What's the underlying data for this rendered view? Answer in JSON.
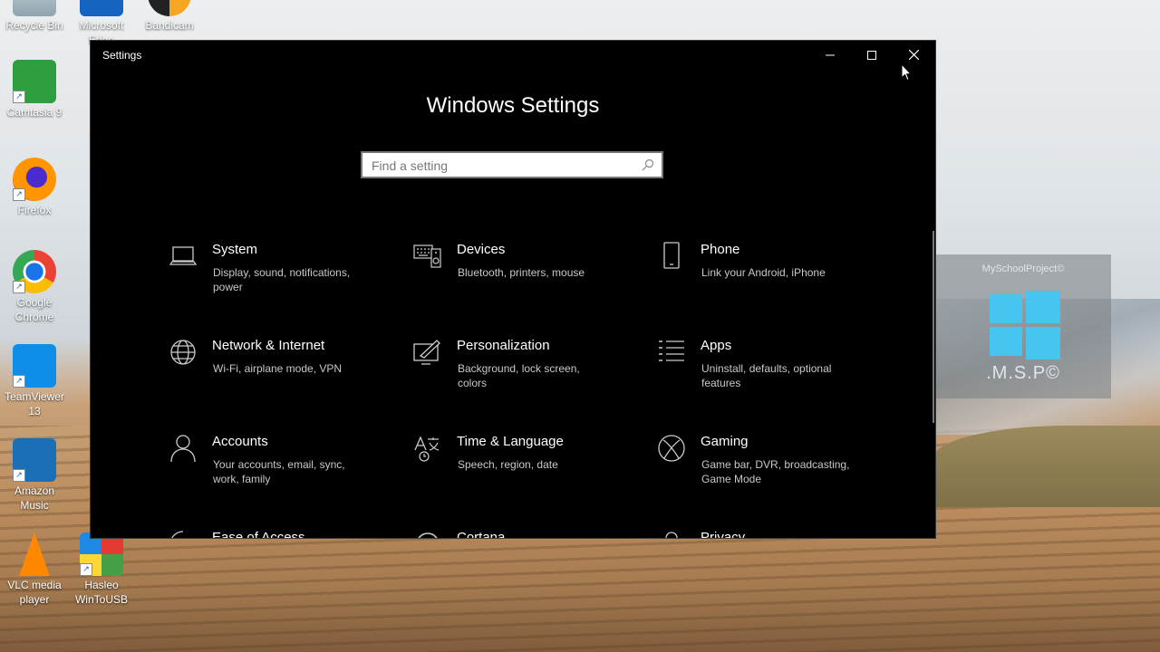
{
  "desktop": {
    "icons": [
      {
        "label": "Recycle Bin",
        "icon": "recycle-bin-icon"
      },
      {
        "label": "Microsoft Edge",
        "icon": "edge-icon"
      },
      {
        "label": "Bandicam",
        "icon": "bandicam-icon"
      },
      {
        "label": "Camtasia 9",
        "icon": "camtasia-icon"
      },
      {
        "label": "Firefox",
        "icon": "firefox-icon"
      },
      {
        "label": "Google Chrome",
        "icon": "chrome-icon"
      },
      {
        "label": "TeamViewer 13",
        "icon": "teamviewer-icon"
      },
      {
        "label": "Amazon Music",
        "icon": "amazon-music-icon"
      },
      {
        "label": "VLC media player",
        "icon": "vlc-icon"
      },
      {
        "label": "Hasleo WinToUSB",
        "icon": "wintousb-icon"
      }
    ],
    "widget": {
      "brand": "MySchoolProject©",
      "sub": ".M.S.P©"
    }
  },
  "window": {
    "title": "Settings",
    "heading": "Windows Settings",
    "search": {
      "placeholder": "Find a setting"
    },
    "controls": {
      "minimize": "—",
      "maximize": "☐",
      "close": "✕"
    },
    "tiles": [
      {
        "name": "System",
        "desc": "Display, sound, notifications, power",
        "icon": "laptop-icon"
      },
      {
        "name": "Devices",
        "desc": "Bluetooth, printers, mouse",
        "icon": "keyboard-speaker-icon"
      },
      {
        "name": "Phone",
        "desc": "Link your Android, iPhone",
        "icon": "phone-icon"
      },
      {
        "name": "Network & Internet",
        "desc": "Wi-Fi, airplane mode, VPN",
        "icon": "globe-icon"
      },
      {
        "name": "Personalization",
        "desc": "Background, lock screen, colors",
        "icon": "paint-monitor-icon"
      },
      {
        "name": "Apps",
        "desc": "Uninstall, defaults, optional features",
        "icon": "list-icon"
      },
      {
        "name": "Accounts",
        "desc": "Your accounts, email, sync, work, family",
        "icon": "person-icon"
      },
      {
        "name": "Time & Language",
        "desc": "Speech, region, date",
        "icon": "language-icon"
      },
      {
        "name": "Gaming",
        "desc": "Game bar, DVR, broadcasting, Game Mode",
        "icon": "xbox-icon"
      },
      {
        "name": "Ease of Access",
        "desc": "",
        "icon": "ease-of-access-icon"
      },
      {
        "name": "Cortana",
        "desc": "",
        "icon": "cortana-icon"
      },
      {
        "name": "Privacy",
        "desc": "",
        "icon": "lock-icon"
      }
    ]
  }
}
